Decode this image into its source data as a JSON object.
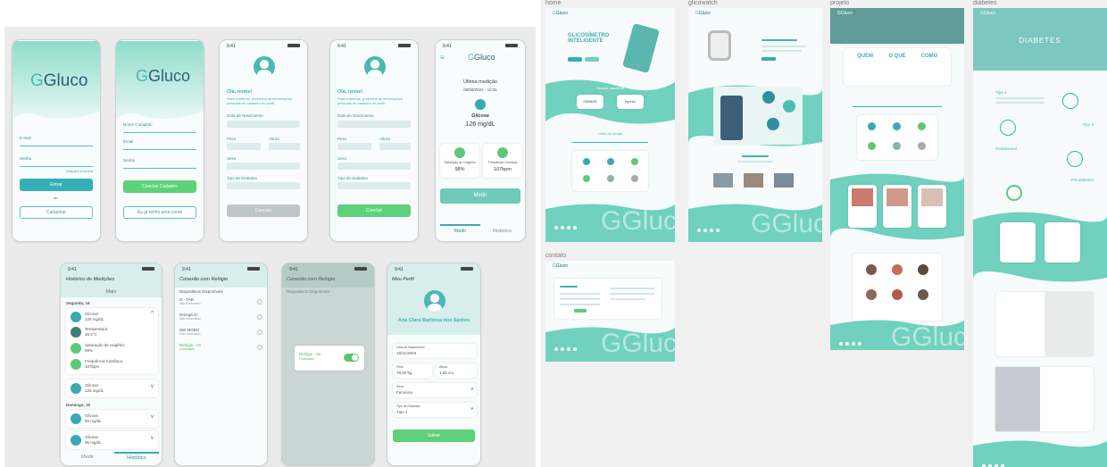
{
  "app": {
    "brand": "Gluco",
    "brand_mark": "G"
  },
  "colors": {
    "teal": "#35aeb8",
    "mint": "#6fd1be",
    "green": "#5ed17a",
    "dark_blue": "#2b5f7a",
    "bg": "#ebebeb"
  },
  "right_sections": {
    "home": "home",
    "glicowatch": "glicowatch",
    "projeto": "projeto",
    "diabetes": "diabetes",
    "contato": "contato"
  },
  "login": {
    "email_label": "E-mail",
    "password_label": "Senha",
    "forgot": "Esqueci a senha",
    "enter": "Entrar",
    "or": "ou",
    "register": "Cadastrar"
  },
  "register": {
    "name_label": "Nome Completo",
    "email_label": "Email",
    "password_label": "Senha",
    "register_btn": "Concluir Cadastro",
    "login_link": "Eu já tenho uma conta"
  },
  "profile_setup_1": {
    "greeting": "Olá, nome!",
    "desc": "Para continuar, preencha as informações pessoais do cadastro do perfil.",
    "birth": "Data de Nascimento",
    "weight": "Peso",
    "height": "Altura",
    "sex": "Sexo",
    "diabetes_type": "Tipo de Diabetes",
    "continue": "Concluir"
  },
  "profile_setup_2": {
    "greeting": "Olá, nome!",
    "desc": "Para continuar, preencha as informações pessoais do cadastro do perfil.",
    "birth": "Data de Nascimento",
    "weight": "Peso",
    "height": "Altura",
    "sex": "Sexo",
    "diabetes_type": "Tipo de Diabetes",
    "continue": "Concluir"
  },
  "measure": {
    "last": "Última medição",
    "date": "08/08/2024 - 10:31",
    "glucose_label": "Glicose",
    "glucose_value": "126 mg/dL",
    "oxygen_label": "Saturação de Oxigênio",
    "oxygen_value": "98%",
    "heart_label": "Frequência Cardíaca",
    "heart_value": "107bpm",
    "measure_btn": "Medir",
    "tab_measure": "Medir",
    "tab_history": "Histórico"
  },
  "history": {
    "title": "Histórico de Medições",
    "month": "Maio",
    "day1": "Segunda, 16",
    "items": [
      {
        "label": "Glicose",
        "value": "126 mg/dL"
      },
      {
        "label": "Temperatura",
        "value": "36.5°C"
      },
      {
        "label": "Saturação de oxigênio",
        "value": "98%"
      },
      {
        "label": "Frequência Cardíaca",
        "value": "107bpm"
      }
    ],
    "item2_label": "Glicose",
    "item2_value": "126 mg/dL",
    "day2": "Domingo, 15",
    "item3_label": "Glicose",
    "item3_value": "90 mg/dL",
    "item4_label": "Glicose",
    "item4_value": "85 mg/dL",
    "tab_measure": "Medir",
    "tab_history": "Histórico"
  },
  "watch": {
    "title": "Conexão com Relógio",
    "section": "Dispositivos Disponíveis",
    "devices": [
      "G - TAB",
      "Omega 3+",
      "SW MOBO",
      "Relógio - 01"
    ],
    "status": [
      "Não conectado",
      "Não conectado",
      "Não conectado",
      "Conectado"
    ]
  },
  "watch_modal": {
    "title": "Conexão com Relógio",
    "section": "Dispositivos Disponíveis",
    "device": "Relógio - 01",
    "device_status": "Conectado"
  },
  "my_profile": {
    "title": "Meu Perfil",
    "name": "Ana Clara Barbosa dos Santos",
    "birth_label": "Data de Nascimento",
    "birth": "16/11/2004",
    "weight_label": "Peso",
    "weight": "78,00 kg",
    "height_label": "Altura",
    "height": "1,65 cm",
    "sex_label": "Sexo",
    "sex": "Feminino",
    "type_label": "Tipo de Diabetes",
    "type": "Tipo 1",
    "save": "Salvar"
  },
  "home_page": {
    "headline": "GLICOSÍMETRO INTELIGENTE",
    "partners": "Nossos parceiros",
    "partner1": "GENIUS",
    "partner2": "fapese",
    "about": "Linha do tempo"
  },
  "project_page": {
    "who": "QUEM",
    "what": "O QUE",
    "how": "COMO"
  },
  "diabetes_page": {
    "title": "DIABETES",
    "type1": "Tipo 1",
    "type2": "Tipo 2",
    "gestational": "Gestacional",
    "pre": "Pré-diabetes"
  }
}
